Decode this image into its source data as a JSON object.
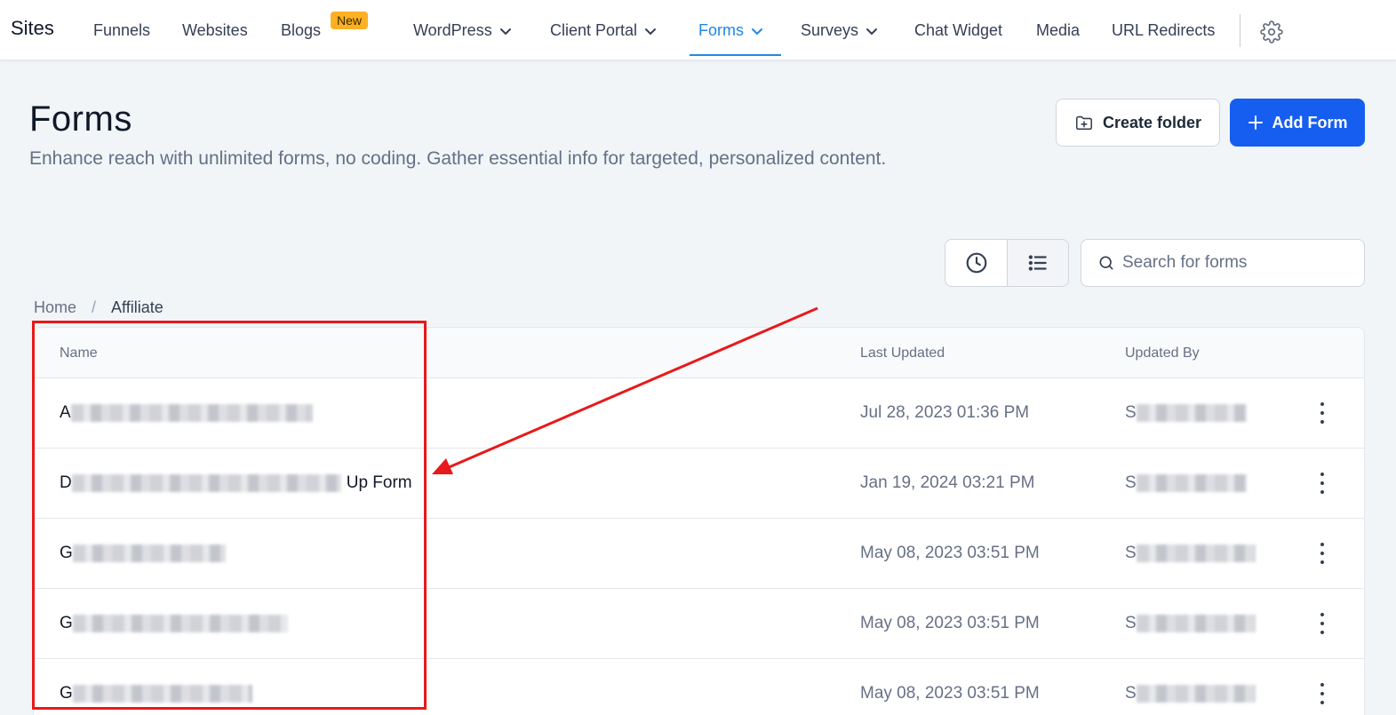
{
  "nav": {
    "brand": "Sites",
    "items": [
      {
        "label": "Funnels"
      },
      {
        "label": "Websites"
      },
      {
        "label": "Blogs",
        "badge": "New"
      },
      {
        "label": "WordPress"
      },
      {
        "label": "Client Portal"
      },
      {
        "label": "Forms",
        "active": true
      },
      {
        "label": "Surveys"
      },
      {
        "label": "Chat Widget"
      },
      {
        "label": "Media"
      },
      {
        "label": "URL Redirects"
      }
    ]
  },
  "header": {
    "title": "Forms",
    "description": "Enhance reach with unlimited forms, no coding. Gather essential info for targeted, personalized content.",
    "create_folder_label": "Create folder",
    "add_form_label": "Add Form"
  },
  "search": {
    "placeholder": "Search for forms",
    "value": ""
  },
  "breadcrumb": {
    "home": "Home",
    "separator": "/",
    "current": "Affiliate"
  },
  "table": {
    "columns": [
      "Name",
      "Last Updated",
      "Updated By"
    ],
    "rows": [
      {
        "name_prefix": "A",
        "name_suffix": "",
        "last_updated": "Jul 28, 2023 01:36 PM",
        "updated_by_prefix": "S"
      },
      {
        "name_prefix": "D",
        "name_suffix": "Up Form",
        "last_updated": "Jan 19, 2024 03:21 PM",
        "updated_by_prefix": "S"
      },
      {
        "name_prefix": "G",
        "name_suffix": "",
        "last_updated": "May 08, 2023 03:51 PM",
        "updated_by_prefix": "S"
      },
      {
        "name_prefix": "G",
        "name_suffix": "",
        "last_updated": "May 08, 2023 03:51 PM",
        "updated_by_prefix": "S"
      },
      {
        "name_prefix": "G",
        "name_suffix": "",
        "last_updated": "May 08, 2023 03:51 PM",
        "updated_by_prefix": "S"
      }
    ]
  },
  "colors": {
    "accent": "#1e88e5",
    "primary_button": "#155eef",
    "badge": "#fdb022",
    "annotation": "#e8191a"
  },
  "icons": [
    "chevron-down-icon",
    "gear-icon",
    "folder-plus-icon",
    "plus-icon",
    "clock-icon",
    "list-icon",
    "search-icon",
    "kebab-menu-icon"
  ]
}
